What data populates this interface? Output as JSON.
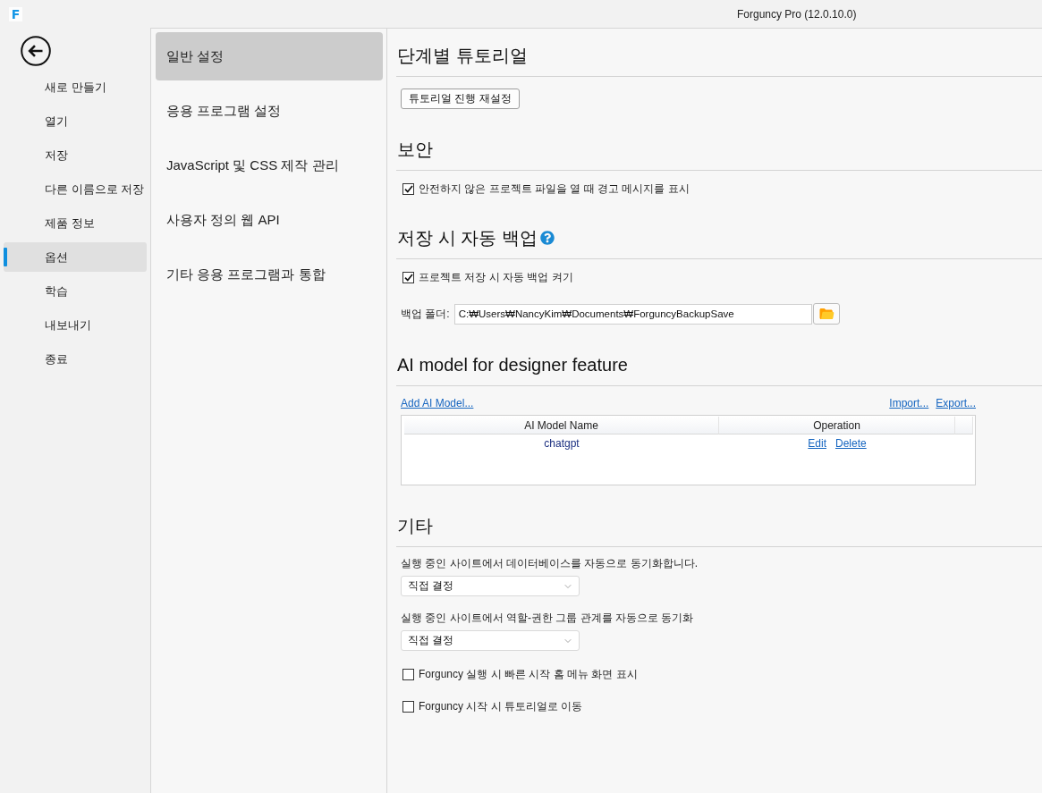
{
  "window": {
    "logo": "F",
    "title": "Forguncy Pro (12.0.10.0)"
  },
  "nav": [
    {
      "label": "새로 만들기",
      "selected": false
    },
    {
      "label": "열기",
      "selected": false
    },
    {
      "label": "저장",
      "selected": false
    },
    {
      "label": "다른 이름으로 저장",
      "selected": false
    },
    {
      "label": "제품 정보",
      "selected": false
    },
    {
      "label": "옵션",
      "selected": true
    },
    {
      "label": "학습",
      "selected": false
    },
    {
      "label": "내보내기",
      "selected": false
    },
    {
      "label": "종료",
      "selected": false
    }
  ],
  "categories": [
    {
      "label": "일반 설정",
      "selected": true
    },
    {
      "label": "응용 프로그램 설정",
      "selected": false
    },
    {
      "label": "JavaScript 및 CSS 제작 관리",
      "selected": false
    },
    {
      "label": "사용자 정의 웹 API",
      "selected": false
    },
    {
      "label": "기타 응용 프로그램과 통합",
      "selected": false
    }
  ],
  "sections": [
    {
      "heading": "단계별 튜토리얼",
      "items": [
        {
          "kind": "button",
          "label": "튜토리얼 진행 재설정"
        }
      ]
    },
    {
      "heading": "보안",
      "items": [
        {
          "kind": "checkbox",
          "label": "안전하지 않은 프로젝트 파일을 열 때 경고 메시지를 표시",
          "checked": true
        }
      ]
    },
    {
      "heading": "저장 시 자동 백업",
      "help": true,
      "items": [
        {
          "kind": "checkbox",
          "label": "프로젝트 저장 시 자동 백업 켜기",
          "checked": true
        },
        {
          "kind": "folder",
          "label": "백업 폴더:",
          "value": "C:₩Users₩NancyKim₩Documents₩ForguncyBackupSave"
        }
      ]
    },
    {
      "heading": "AI model for designer feature",
      "items": [
        {
          "kind": "model_table",
          "add_link": "Add AI Model...",
          "import_link": "Import...",
          "export_link": "Export...",
          "columns": [
            "AI Model Name",
            "Operation"
          ],
          "rows": [
            {
              "name": "chatgpt",
              "actions": [
                "Edit",
                "Delete"
              ]
            }
          ]
        }
      ]
    },
    {
      "heading": "기타",
      "items": [
        {
          "kind": "select",
          "label": "실행 중인 사이트에서 데이터베이스를 자동으로 동기화합니다.",
          "value": "직접 결정"
        },
        {
          "kind": "select",
          "label": "실행 중인 사이트에서 역할-권한 그룹 관계를 자동으로 동기화",
          "value": "직접 결정"
        },
        {
          "kind": "checkbox",
          "label": "Forguncy 실행 시 빠른 시작 홈 메뉴 화면 표시",
          "checked": false
        },
        {
          "kind": "checkbox",
          "label": "Forguncy 시작 시 튜토리얼로 이동",
          "checked": false
        }
      ]
    }
  ]
}
